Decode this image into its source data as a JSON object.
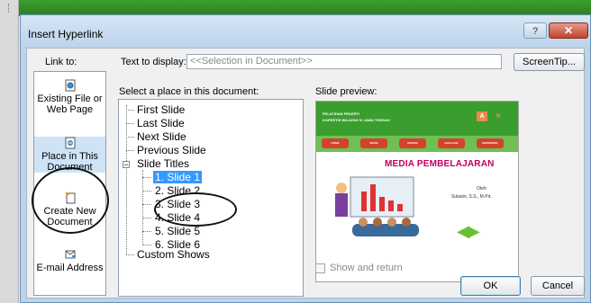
{
  "window": {
    "title": "Insert Hyperlink",
    "help_glyph": "?",
    "close_glyph": "✕"
  },
  "link_to": {
    "label": "Link to:",
    "items": [
      {
        "label_line1": "Existing File or",
        "label_line2": "Web Page",
        "icon": "web-page-icon"
      },
      {
        "label_line1": "Place in This",
        "label_line2": "Document",
        "icon": "document-place-icon",
        "selected": true
      },
      {
        "label_line1": "Create New",
        "label_line2": "Document",
        "icon": "new-document-icon"
      },
      {
        "label_line1": "E-mail Address",
        "label_line2": "",
        "icon": "email-icon"
      }
    ]
  },
  "text_to_display": {
    "label": "Text to display:",
    "value": "<<Selection in Document>>",
    "screentip_button": "ScreenTip..."
  },
  "place": {
    "label": "Select a place in this document:",
    "items": [
      "First Slide",
      "Last Slide",
      "Next Slide",
      "Previous Slide"
    ],
    "slide_titles_label": "Slide Titles",
    "expander_glyph": "−",
    "slides": [
      "1. Slide 1",
      "2. Slide 2",
      "3. Slide 3",
      "4. Slide 4",
      "5. Slide 5",
      "6. Slide 6"
    ],
    "selected_slide": "1. Slide 1",
    "custom_shows": "Custom Shows"
  },
  "preview": {
    "label": "Slide preview:",
    "header_line1": "PELATIHAN PEKERTI",
    "header_line2": "KOPERTIS WILAYAH VI JAWA TENGAH",
    "badge_a": "A",
    "badge_x": "✕",
    "nav": [
      "HOME",
      "SK/KD",
      "MATERI",
      "EVALUASI",
      "REFERENSI"
    ],
    "title": "MEDIA PEMBELAJARAN",
    "author_label": "Oleh:",
    "author_name": "Sulastri, S.S., M.Pd.",
    "arrows": "◀▶",
    "show_and_return": "Show and return"
  },
  "buttons": {
    "ok": "OK",
    "cancel": "Cancel"
  },
  "colors": {
    "slide_green": "#3a9e2e",
    "nav_red": "#d4412d",
    "title_pink": "#c00060",
    "selection_blue": "#3399ff"
  }
}
